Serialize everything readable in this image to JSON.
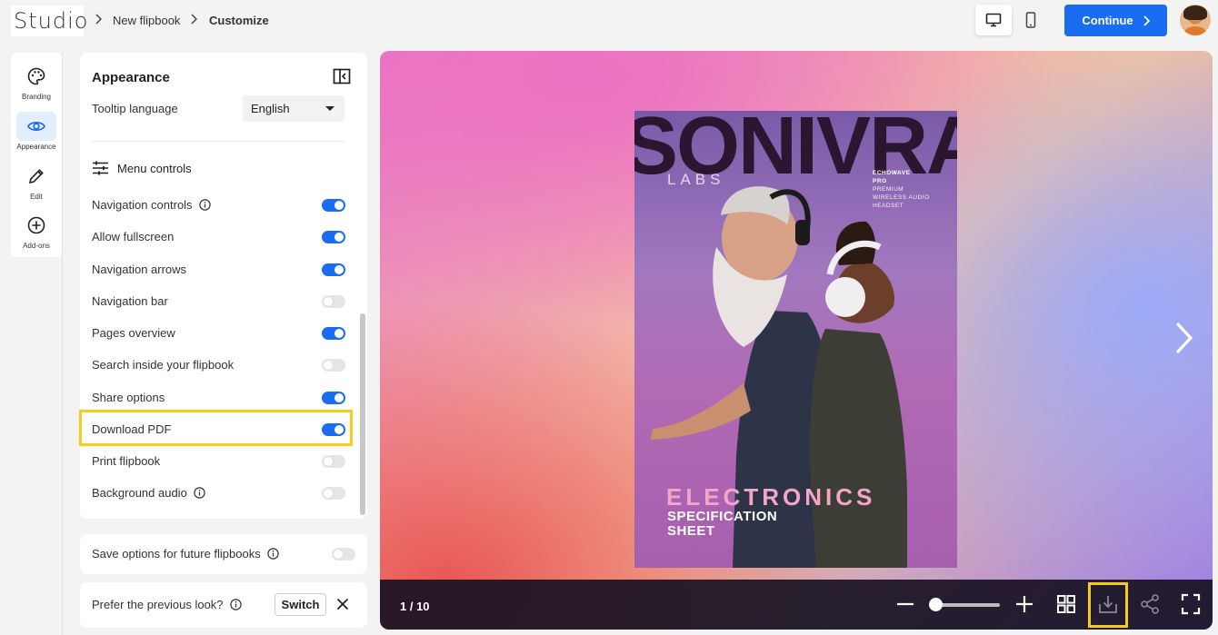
{
  "header": {
    "logo": "Studio",
    "breadcrumb": [
      "New flipbook",
      "Customize"
    ],
    "continue_label": "Continue"
  },
  "rail": {
    "items": [
      {
        "label": "Branding",
        "icon": "palette-icon"
      },
      {
        "label": "Appearance",
        "icon": "eye-icon"
      },
      {
        "label": "Edit",
        "icon": "pencil-icon"
      },
      {
        "label": "Add-ons",
        "icon": "plus-circle-icon"
      }
    ]
  },
  "panel": {
    "title": "Appearance",
    "tooltip_language_label": "Tooltip language",
    "tooltip_language_value": "English",
    "menu_controls_label": "Menu controls",
    "controls": [
      {
        "label": "Navigation controls",
        "on": true,
        "info": true
      },
      {
        "label": "Allow fullscreen",
        "on": true,
        "info": false
      },
      {
        "label": "Navigation arrows",
        "on": true,
        "info": false
      },
      {
        "label": "Navigation bar",
        "on": false,
        "info": false
      },
      {
        "label": "Pages overview",
        "on": true,
        "info": false
      },
      {
        "label": "Search inside your flipbook",
        "on": false,
        "info": false
      },
      {
        "label": "Share options",
        "on": true,
        "info": false
      },
      {
        "label": "Download PDF",
        "on": true,
        "info": false
      },
      {
        "label": "Print flipbook",
        "on": false,
        "info": false
      },
      {
        "label": "Background audio",
        "on": false,
        "info": true
      }
    ]
  },
  "save_card": {
    "label": "Save options for future flipbooks",
    "on": false
  },
  "prefer_card": {
    "label": "Prefer the previous look?",
    "switch_label": "Switch"
  },
  "preview": {
    "cover": {
      "title": "SONIVRA",
      "subtitle": "LABS",
      "brand_line1": "ECHOWAVE",
      "brand_line2": "PRO",
      "brand_line3": "PREMIUM",
      "brand_line4": "WIRELESS AUDIO",
      "brand_line5": "HEADSET",
      "headline": "ELECTRONICS",
      "sub1": "SPECIFICATION",
      "sub2": "SHEET"
    },
    "page_indicator": "1 / 10",
    "zoom_level": 0
  },
  "colors": {
    "accent": "#1a6cf0",
    "highlight": "#f6cd1c"
  }
}
